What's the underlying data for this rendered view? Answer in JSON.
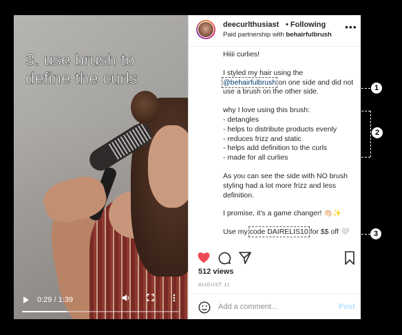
{
  "video": {
    "overlay_text": "3. use brush to define the curls",
    "time": "0:29 / 1:39",
    "progress": 0.29,
    "icons": [
      "play-icon",
      "volume-icon",
      "fullscreen-icon",
      "more-vert-icon"
    ]
  },
  "post": {
    "username": "deecurlthusiast",
    "follow_label": "• Following",
    "partnership_prefix": "Paid partnership with ",
    "partner": "behairfulbrush",
    "more_icon": "•••",
    "caption": {
      "l1": "Hiiii curlies!",
      "l2a": "I styled my hair using the",
      "l2_mention": "@behairfulbrush",
      "l2b": " on one side and did not use a brush on the other side.",
      "l3": "why I love using this brush:",
      "b1": "- detangles",
      "b2": "- helps to distribute products evenly",
      "b3": "- reduces frizz and static",
      "b4": "- helps add definition to the curls",
      "b5": "- made for all curlies",
      "l4": "As you can see the side with NO brush styling had a lot more frizz and less definition.",
      "l5": "I promise, it’s a game changer! 👏🏻✨",
      "l6a": "Use my ",
      "l6_code": "code DAIRELIS10",
      "l6b": " for $$ off 🤍"
    },
    "views": "512 views",
    "date": "AUGUST 11",
    "comment_placeholder": "Add a comment...",
    "post_label": "Post"
  },
  "annotations": [
    "1",
    "2",
    "3"
  ],
  "colors": {
    "heart": "#ed4956",
    "link": "#00376b",
    "post_disabled": "#b2dffc"
  }
}
